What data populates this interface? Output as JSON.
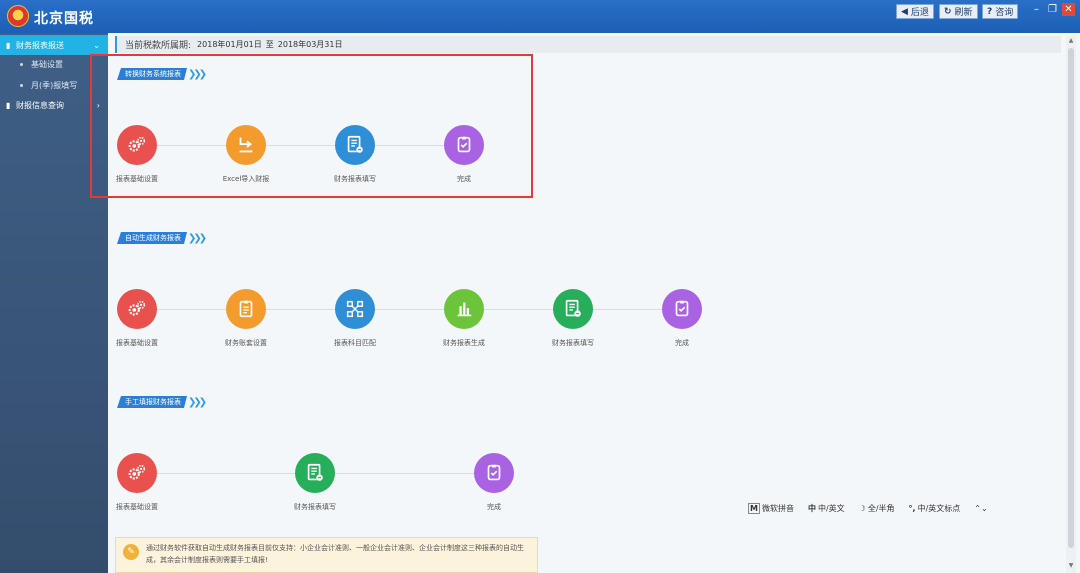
{
  "app": {
    "title": "北京国税"
  },
  "toolbar": {
    "back": "后退",
    "refresh": "刷新",
    "help": "咨询"
  },
  "sidebar": {
    "items": [
      {
        "label": "财务报表报送",
        "active": true
      },
      {
        "label": "基础设置"
      },
      {
        "label": "月(季)报填写"
      },
      {
        "label": "财报信息查询"
      }
    ]
  },
  "period": {
    "label": "当前税款所属期:",
    "start": "2018年01月01日",
    "sep": "至",
    "end": "2018年03月31日"
  },
  "sections": [
    {
      "title": "转换财务系统报表",
      "steps": [
        {
          "label": "报表基础设置",
          "icon": "gears-icon",
          "color": "#e8514d"
        },
        {
          "label": "Excel导入财报",
          "icon": "import-icon",
          "color": "#f39b2c"
        },
        {
          "label": "财务报表填写",
          "icon": "form-edit-icon",
          "color": "#2f8fd6"
        },
        {
          "label": "完成",
          "icon": "finish-icon",
          "color": "#a862e2"
        }
      ]
    },
    {
      "title": "自动生成财务报表",
      "steps": [
        {
          "label": "报表基础设置",
          "icon": "gears-icon",
          "color": "#e8514d"
        },
        {
          "label": "财务账套设置",
          "icon": "clipboard-icon",
          "color": "#f39b2c"
        },
        {
          "label": "报表科目匹配",
          "icon": "network-icon",
          "color": "#2f8fd6"
        },
        {
          "label": "财务报表生成",
          "icon": "bar-chart-icon",
          "color": "#6cc43b"
        },
        {
          "label": "财务报表填写",
          "icon": "form-edit-icon",
          "color": "#27ae5a"
        },
        {
          "label": "完成",
          "icon": "finish-icon",
          "color": "#a862e2"
        }
      ]
    },
    {
      "title": "手工填报财务报表",
      "steps": [
        {
          "label": "报表基础设置",
          "icon": "gears-icon",
          "color": "#e8514d"
        },
        {
          "label": "财务报表填写",
          "icon": "form-edit-icon",
          "color": "#27ae5a"
        },
        {
          "label": "完成",
          "icon": "finish-icon",
          "color": "#a862e2"
        }
      ]
    }
  ],
  "ime": {
    "pinyin": "微软拼音",
    "lang": "中/英文",
    "width": "全/半角",
    "punct": "中/英文标点"
  },
  "notice": {
    "text": "通过财务软件获取自动生成财务报表目前仅支持：小企业会计准则、一般企业会计准则、企业会计制度这三种报表的自动生成，其余会计制度报表则需要手工填报!"
  }
}
